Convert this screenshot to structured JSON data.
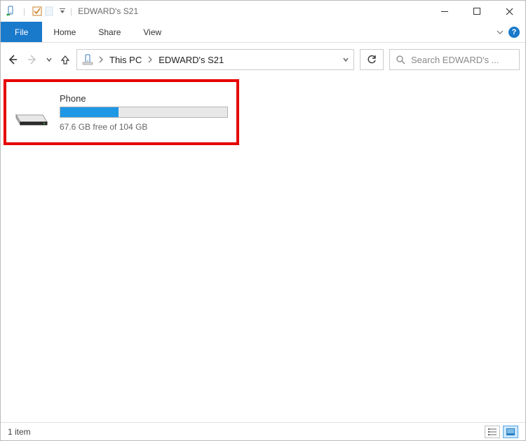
{
  "window": {
    "title": "EDWARD's S21",
    "minimize_icon": "minimize-icon",
    "maximize_icon": "maximize-icon",
    "close_icon": "close-icon"
  },
  "ribbon": {
    "file": "File",
    "home": "Home",
    "share": "Share",
    "view": "View",
    "help_label": "?"
  },
  "nav": {
    "breadcrumb": {
      "root": "This PC",
      "current": "EDWARD's S21"
    }
  },
  "search": {
    "placeholder": "Search EDWARD's ..."
  },
  "content": {
    "drive": {
      "name": "Phone",
      "free_text": "67.6 GB free of 104 GB",
      "used_percent": 35
    }
  },
  "status": {
    "item_count": "1 item"
  }
}
